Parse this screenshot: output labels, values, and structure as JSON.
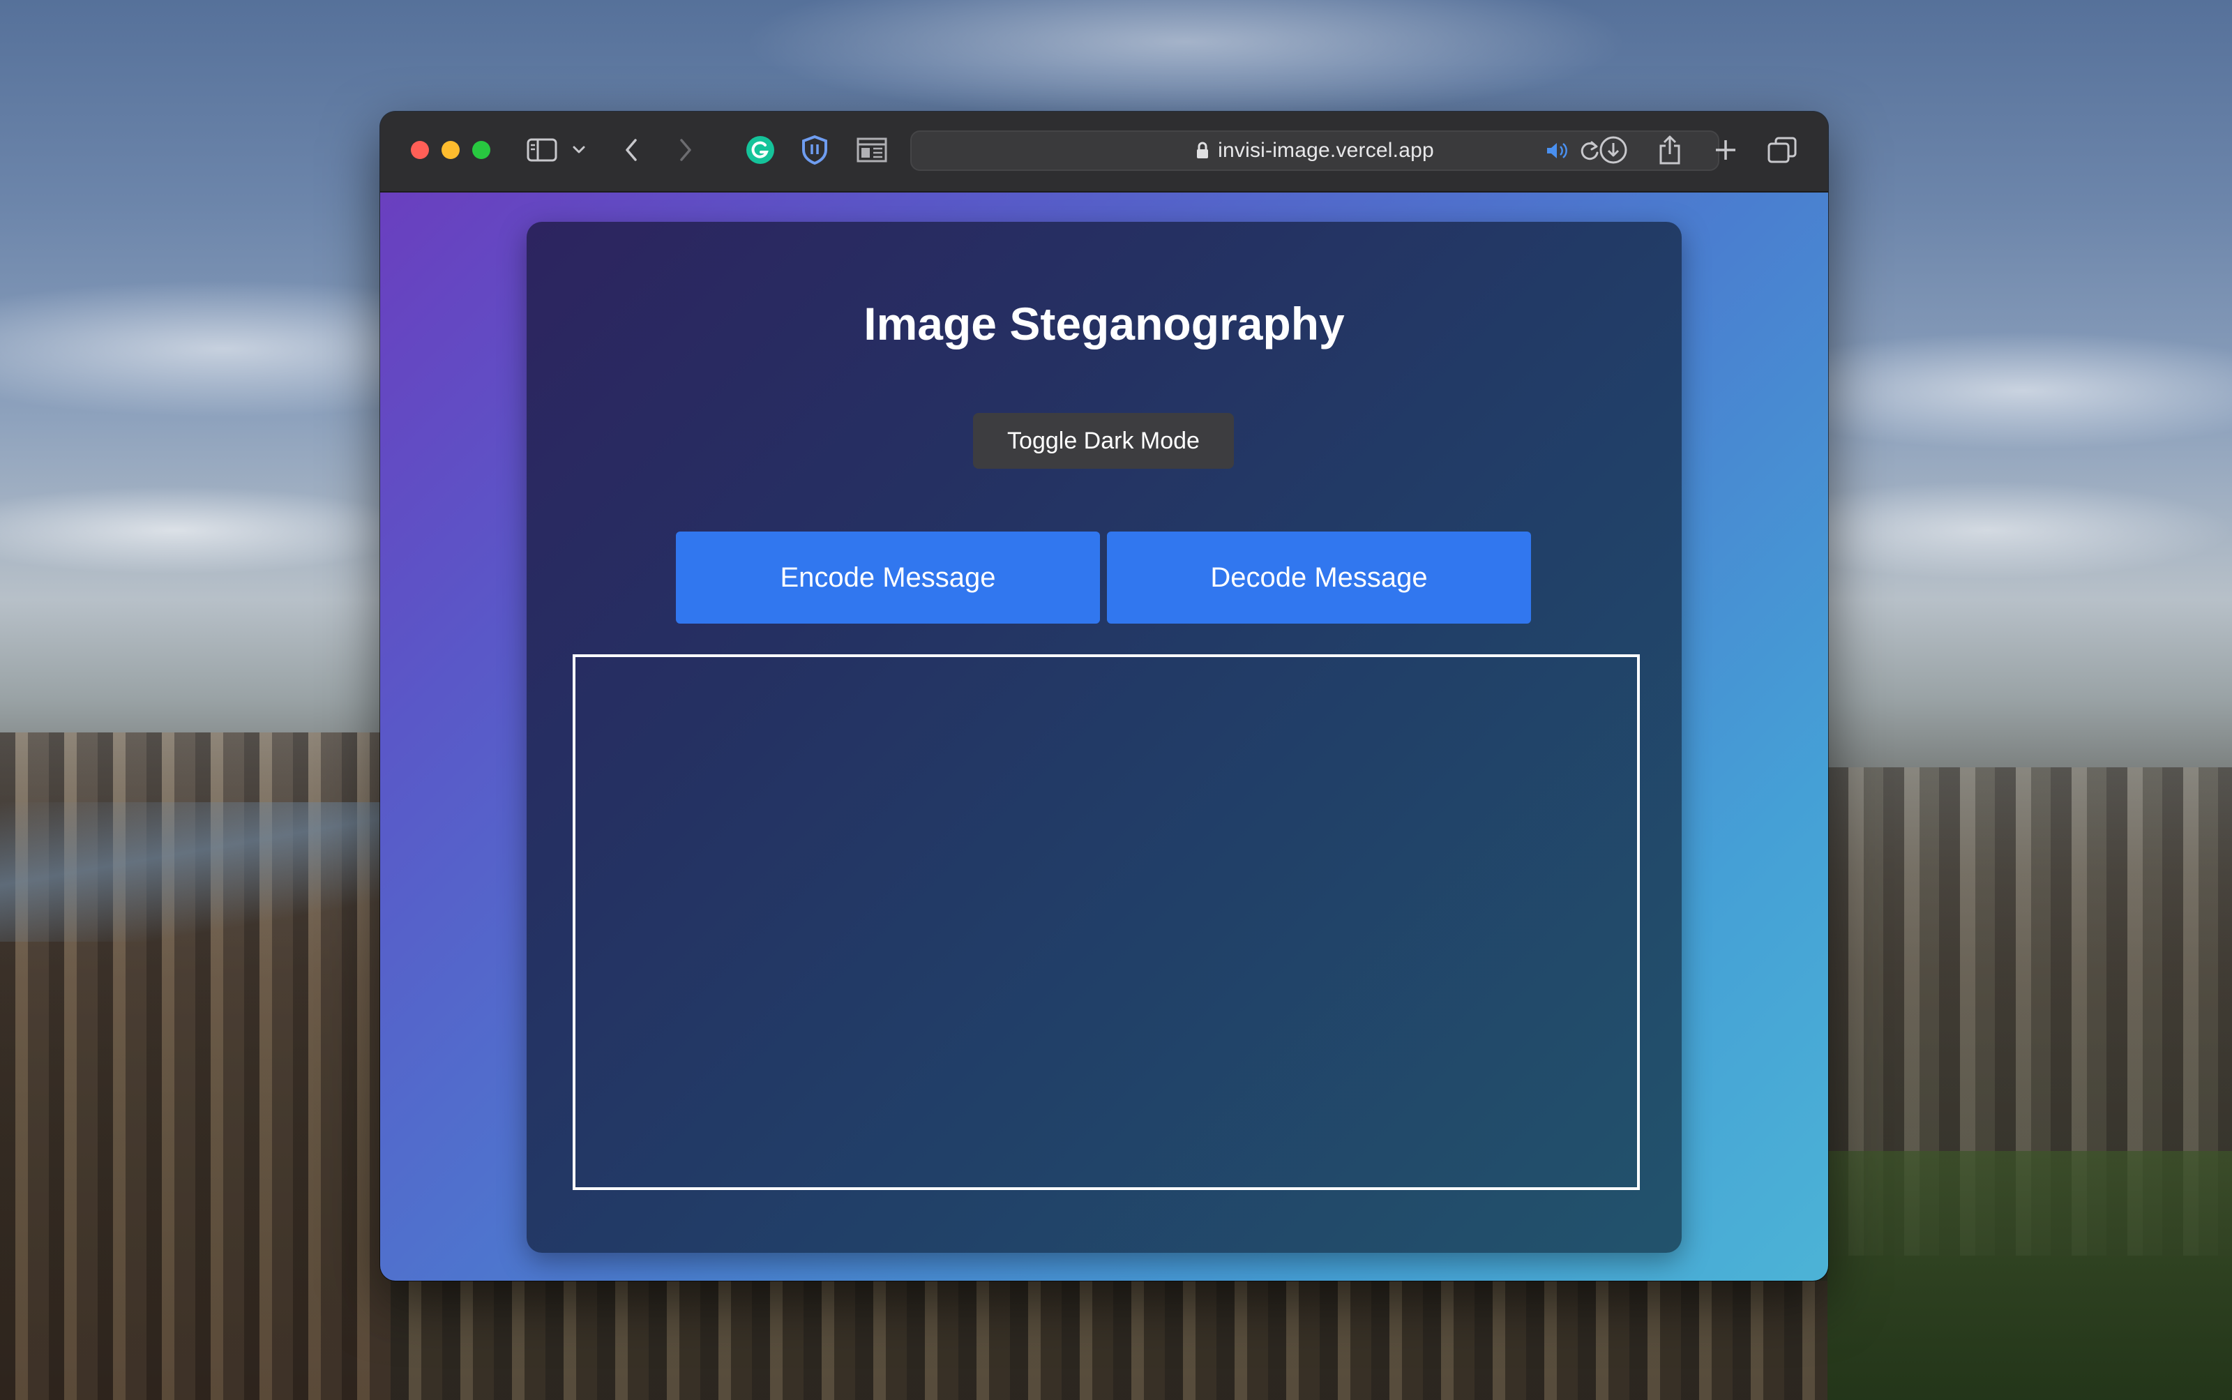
{
  "browser": {
    "url": "invisi-image.vercel.app"
  },
  "page": {
    "title": "Image Steganography",
    "toggle_label": "Toggle Dark Mode",
    "encode_label": "Encode Message",
    "decode_label": "Decode Message"
  },
  "colors": {
    "accent_button": "#3177ef",
    "toggle_button": "#3d3d40",
    "grammarly_green": "#15c39a",
    "bitwarden_blue": "#6f9df0",
    "audio_blue": "#4a90f0"
  },
  "icons": [
    "sidebar-icon",
    "chevron-down-icon",
    "back-icon",
    "forward-icon",
    "grammarly-icon",
    "shield-extension-icon",
    "reader-icon",
    "lock-icon",
    "audio-icon",
    "reload-icon",
    "download-icon",
    "share-icon",
    "new-tab-icon",
    "tabs-overview-icon"
  ]
}
